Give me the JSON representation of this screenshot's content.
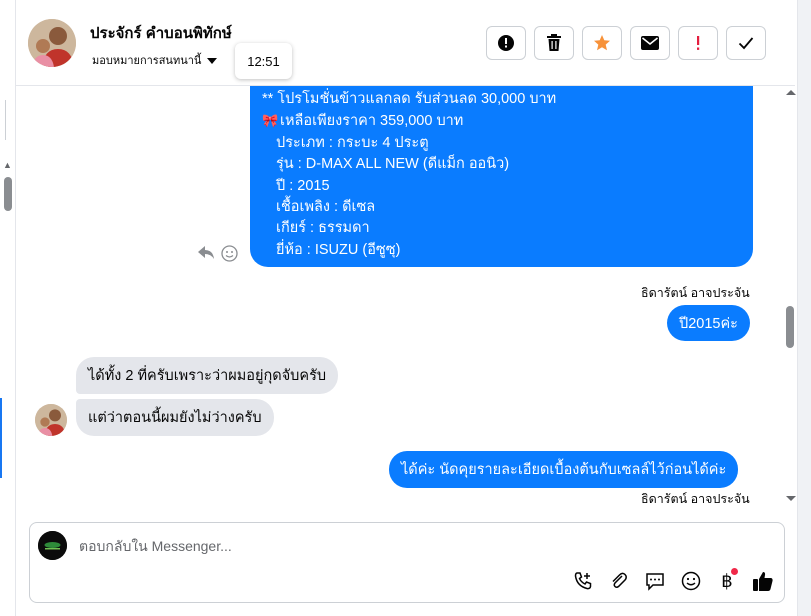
{
  "header": {
    "contact_name": "ประจักร์ คำบอนพิทักษ์",
    "assign_label": "มอบหมายการสนทนานี้",
    "tooltip_time": "12:51",
    "actions": [
      {
        "name": "mark-spam-button",
        "icon": "alert-circle-icon"
      },
      {
        "name": "delete-button",
        "icon": "trash-icon"
      },
      {
        "name": "star-button",
        "icon": "star-icon"
      },
      {
        "name": "mark-unread-button",
        "icon": "envelope-icon"
      },
      {
        "name": "follow-up-button",
        "icon": "exclamation-icon"
      },
      {
        "name": "mark-done-button",
        "icon": "checkmark-icon"
      }
    ]
  },
  "messages": {
    "promo": {
      "line1": "** โปรโมชั่นข้าวแลกลด รับส่วนลด 30,000 บาท",
      "line2": "เหลือเพียงราคา 359,000 บาท",
      "line3": "ประเภท : กระบะ 4 ประตู",
      "line4": "รุ่น : D-MAX ALL NEW (ดีแม็ก ออนิว)",
      "line5": "ปี : 2015",
      "line6": "เชื้อเพลิง : ดีเซล",
      "line7": "เกียร์ : ธรรมดา",
      "line8": "ยี่ห้อ : ISUZU (อีซูซุ)"
    },
    "sender_page": "ธิดารัตน์ อาจประจัน",
    "out_year": "ปี2015ค่ะ",
    "in_1": "ได้ทั้ง 2 ที่ครับเพราะว่าผมอยู่กุดจับครับ",
    "in_2": "แต่ว่าตอนนี้ผมยังไม่ว่างครับ",
    "out_last": "ได้ค่ะ นัดคุยรายละเอียดเบื้องต้นกับเซลล์ไว้ก่อนได้ค่ะ",
    "sender_page_2": "ธิดารัตน์ อาจประจัน"
  },
  "composer": {
    "placeholder": "ตอบกลับใน Messenger...",
    "tools": [
      "call-add-icon",
      "paperclip-icon",
      "saved-reply-icon",
      "emoji-icon",
      "baht-payment-icon",
      "thumbs-up-icon"
    ]
  },
  "colors": {
    "outgoing_bubble": "#0a7cff",
    "incoming_bubble": "#e4e6eb",
    "star": "#f7923a",
    "follow_up": "#e41e3f"
  }
}
